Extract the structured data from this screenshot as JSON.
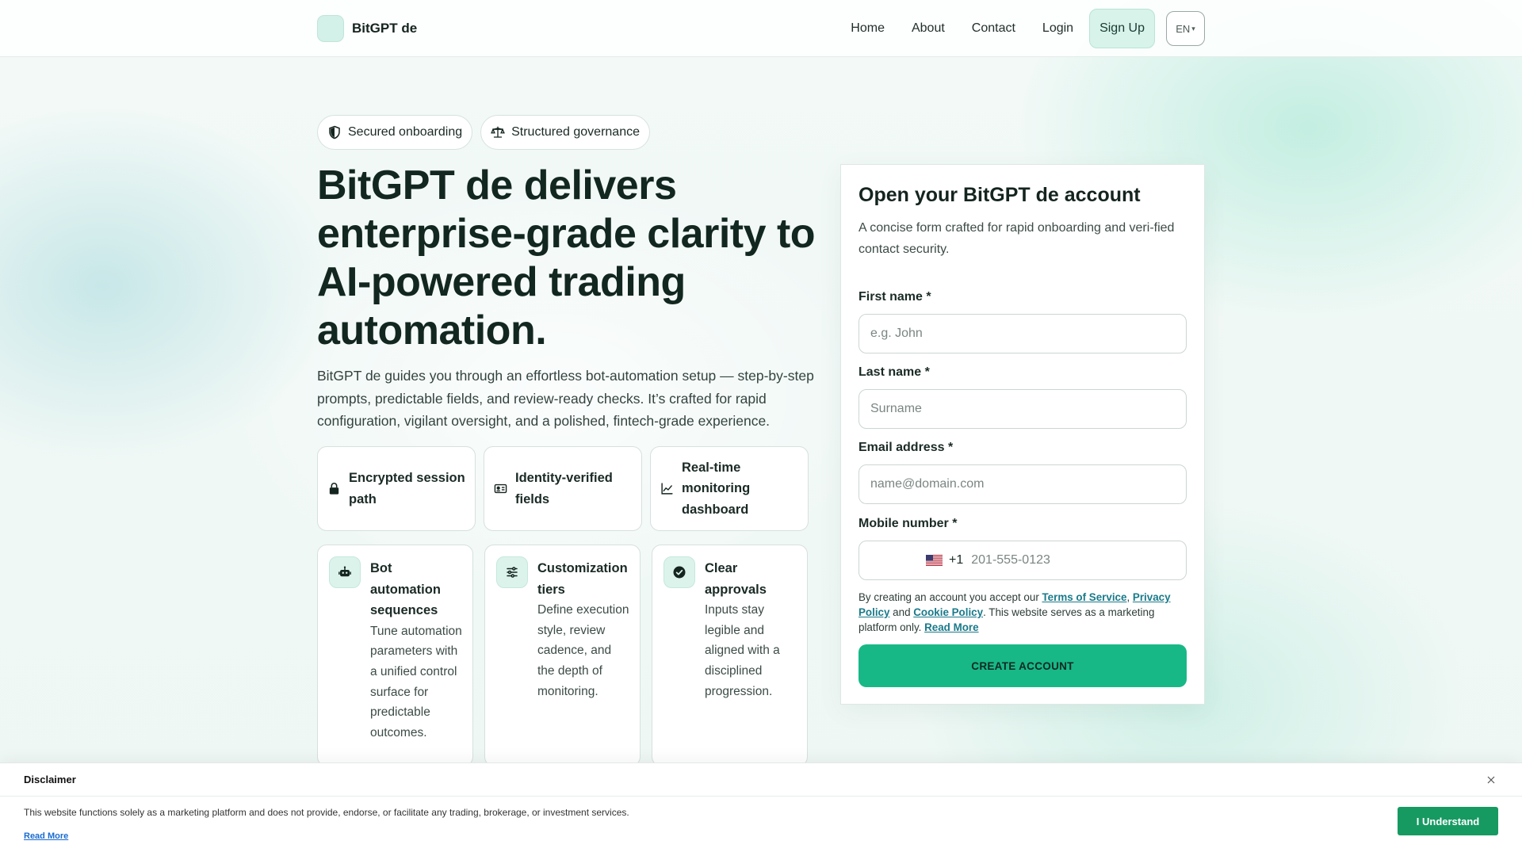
{
  "header": {
    "brand": "BitGPT de",
    "nav": [
      "Home",
      "About",
      "Contact",
      "Login"
    ],
    "signup": "Sign Up",
    "language": "EN",
    "language_caret": "▾"
  },
  "hero": {
    "badges": [
      "Secured onboarding",
      "Structured governance"
    ],
    "title": "BitGPT de delivers enterprise-grade clarity to AI-powered trading automation.",
    "description": "BitGPT de guides you through an effortless bot-automation setup — step-by-step prompts, predictable fields, and review-ready checks. It’s crafted for rapid configuration, vigilant oversight, and a polished, fintech-grade experience.",
    "features": [
      {
        "icon": "lock-icon",
        "label": "Encrypted session path"
      },
      {
        "icon": "id-card-icon",
        "label": "Identity-verified fields"
      },
      {
        "icon": "chart-line-icon",
        "label": "Real-time monitoring dashboard"
      }
    ],
    "cards": [
      {
        "icon": "robot-icon",
        "title": "Bot automation sequences",
        "text": "Tune automation parameters with a unified control surface for predictable outcomes."
      },
      {
        "icon": "sliders-icon",
        "title": "Customization tiers",
        "text": "Define execution style, review cadence, and the depth of monitoring."
      },
      {
        "icon": "check-circle-icon",
        "title": "Clear approvals",
        "text": "Inputs stay legible and aligned with a disciplined progression."
      }
    ]
  },
  "form": {
    "title": "Open your BitGPT de account",
    "subtitle": "A concise form crafted for rapid onboarding and veri-fied contact security.",
    "first_name": {
      "label": "First name *",
      "placeholder": "e.g. John"
    },
    "last_name": {
      "label": "Last name *",
      "placeholder": "Surname"
    },
    "email": {
      "label": "Email address *",
      "placeholder": "name@domain.com"
    },
    "mobile": {
      "label": "Mobile number *",
      "dial_code": "+1",
      "placeholder": "201-555-0123"
    },
    "terms": {
      "prefix": "By creating an account you accept our ",
      "tos": "Terms of Service",
      "sep1": ", ",
      "privacy": "Privacy Policy",
      "sep2": " and ",
      "cookie": "Cookie Policy",
      "suffix": ". This website serves as a marketing platform only. ",
      "read_more": "Read More"
    },
    "submit": "CREATE ACCOUNT"
  },
  "disclaimer": {
    "title": "Disclaimer",
    "close": "×",
    "text": "This website functions solely as a marketing platform and does not provide, endorse, or facilitate any trading, brokerage, or investment services.",
    "read_more": "Read More",
    "accept": "I Understand"
  },
  "colors": {
    "accent": "#18b886",
    "accent_dark": "#179a62",
    "link": "#1a7a8a",
    "heading": "#12271f"
  }
}
